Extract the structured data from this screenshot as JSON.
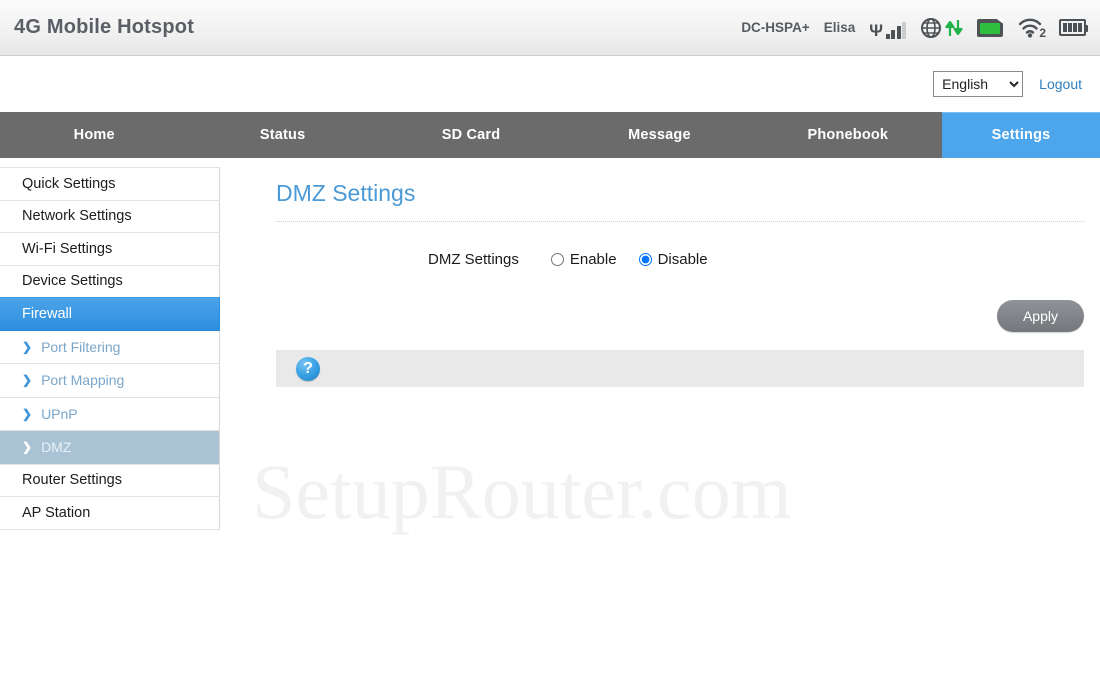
{
  "header": {
    "brand": "4G Mobile Hotspot",
    "network_type": "DC-HSPA+",
    "carrier": "Elisa",
    "icons": {
      "signal": "signal-bars-icon",
      "globe": "globe-data-transfer-icon",
      "sdcard": "sd-card-icon",
      "wifi": "wifi-icon",
      "wifi_clients": "2",
      "battery": "battery-icon"
    }
  },
  "langbar": {
    "language_value": "English",
    "language_options": [
      "English"
    ],
    "logout_label": "Logout"
  },
  "nav": {
    "tabs": [
      {
        "label": "Home",
        "active": false
      },
      {
        "label": "Status",
        "active": false
      },
      {
        "label": "SD Card",
        "active": false
      },
      {
        "label": "Message",
        "active": false
      },
      {
        "label": "Phonebook",
        "active": false
      },
      {
        "label": "Settings",
        "active": true
      }
    ]
  },
  "sidebar": {
    "items": [
      {
        "label": "Quick Settings"
      },
      {
        "label": "Network Settings"
      },
      {
        "label": "Wi-Fi Settings"
      },
      {
        "label": "Device Settings"
      },
      {
        "label": "Firewall"
      },
      {
        "label": "Router Settings"
      },
      {
        "label": "AP Station"
      }
    ],
    "sub_items": [
      {
        "label": "Port Filtering"
      },
      {
        "label": "Port Mapping"
      },
      {
        "label": "UPnP"
      },
      {
        "label": "DMZ"
      }
    ]
  },
  "content": {
    "title": "DMZ Settings",
    "field_label": "DMZ Settings",
    "radio_enable": "Enable",
    "radio_disable": "Disable",
    "selected_value": "Disable",
    "apply_label": "Apply",
    "help_icon": "?"
  },
  "watermark": "SetupRouter.com",
  "colors": {
    "accent_blue": "#4da6ec",
    "nav_gray": "#6b6b6b",
    "title_blue": "#4a9ad6",
    "sub_selected": "#a9c3d4",
    "status_green": "#2fbf3f"
  }
}
